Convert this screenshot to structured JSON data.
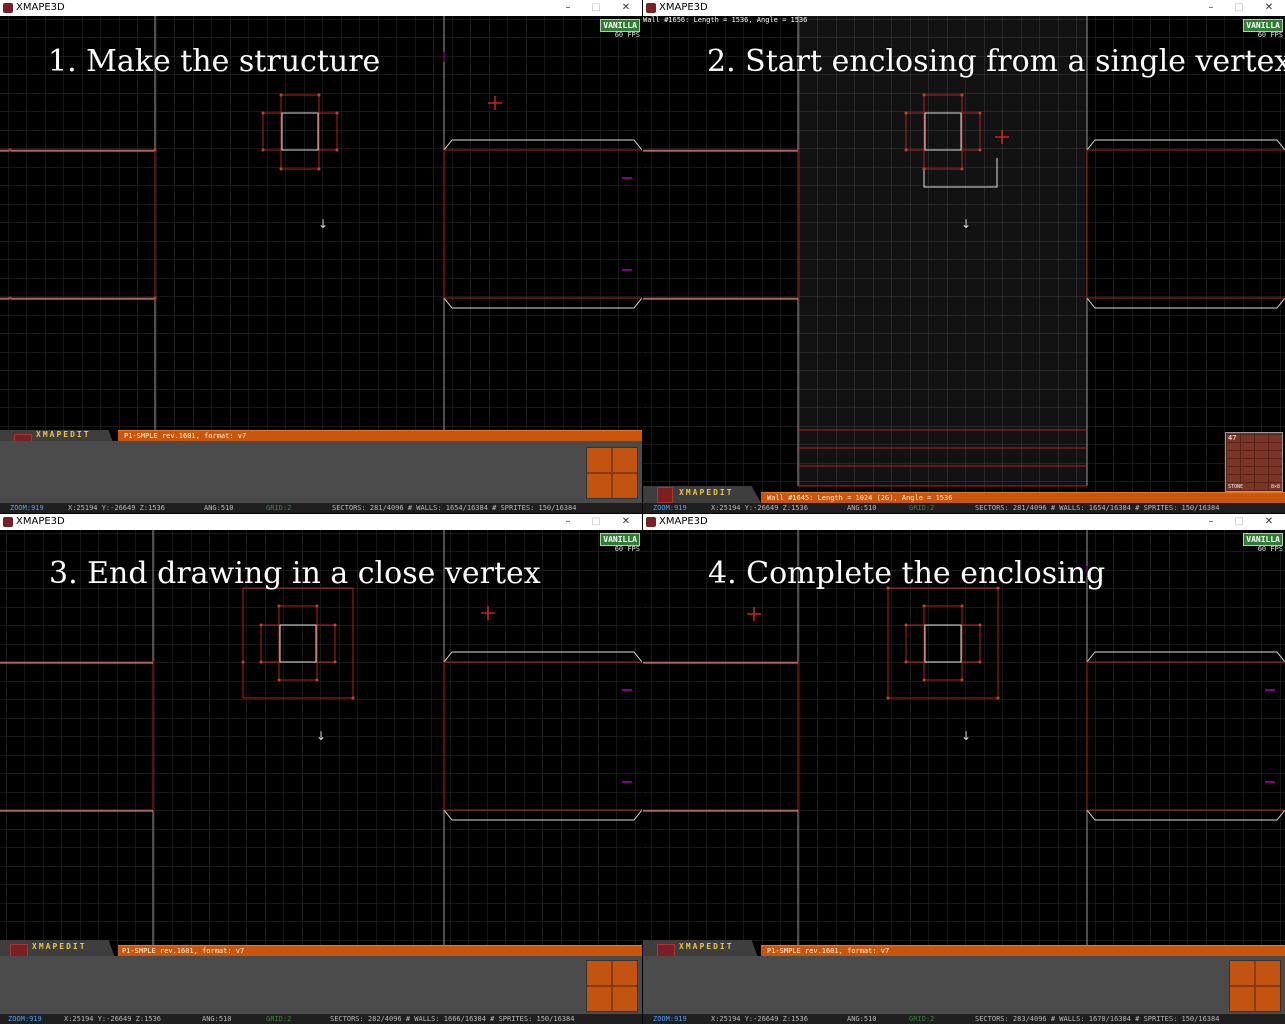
{
  "window_title": "XMAPE3D",
  "vanilla_badge": "VANILLA",
  "fps": "60 FPS",
  "logo_text": "XMAPEDIT",
  "map_info": "P1-SMPLE rev.1601, format: v7",
  "status": {
    "zoom": "ZOOM:919",
    "coords": "X:25194  Y:-26649 Z:1536",
    "ang": "ANG:510",
    "grid": "GRID:2"
  },
  "texture_tile": {
    "number": "47",
    "left": "STONE",
    "right": "8×8"
  },
  "window_controls": {
    "minimize": "–",
    "maximize": "□",
    "close": "✕"
  },
  "panels": [
    {
      "caption": "1. Make the structure",
      "counts": "SECTORS: 281/4096 # WALLS: 1654/16384 # SPRITES: 150/16384"
    },
    {
      "caption": "2. Start enclosing from a single vertex",
      "counts": "SECTORS: 281/4096 # WALLS: 1654/16384 # SPRITES: 150/16384",
      "hud_top": "Wall #1656: Length = 1536, Angle = 1536",
      "hint": "Wall #1645: Length = 1024 (2G), Angle = 1536"
    },
    {
      "caption": "3. End drawing in a close vertex",
      "counts": "SECTORS: 282/4096 # WALLS: 1666/16384 # SPRITES: 150/16384"
    },
    {
      "caption": "4. Complete the enclosing",
      "counts": "SECTORS: 283/4096 # WALLS: 1670/16384 # SPRITES: 150/16384"
    }
  ]
}
